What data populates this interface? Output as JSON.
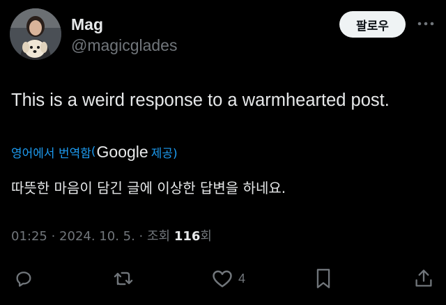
{
  "author": {
    "display_name": "Mag",
    "handle": "@magicglades"
  },
  "follow_label": "팔로우",
  "post": {
    "text": "This is a weird response to a warmhearted post."
  },
  "translation": {
    "link_label": "영어에서 번역함",
    "open_paren": "(",
    "provider": "Google",
    "provided_label": "제공)",
    "text": "따뜻한 마음이 담긴 글에 이상한 답변을 하네요."
  },
  "meta": {
    "time": "01:25",
    "sep1": " · ",
    "date": "2024. 10. 5.",
    "sep2": " · ",
    "views_label": "조회 ",
    "views_count": "116",
    "views_suffix": "회"
  },
  "actions": {
    "like_count": "4"
  },
  "colors": {
    "background": "#000000",
    "primary_text": "#e7e9ea",
    "secondary_text": "#71767b",
    "link": "#1d9bf0",
    "follow_bg": "#eff3f4"
  },
  "icons": [
    "avatar-photo",
    "more-icon",
    "reply-icon",
    "repost-icon",
    "like-icon",
    "bookmark-icon",
    "share-icon"
  ]
}
